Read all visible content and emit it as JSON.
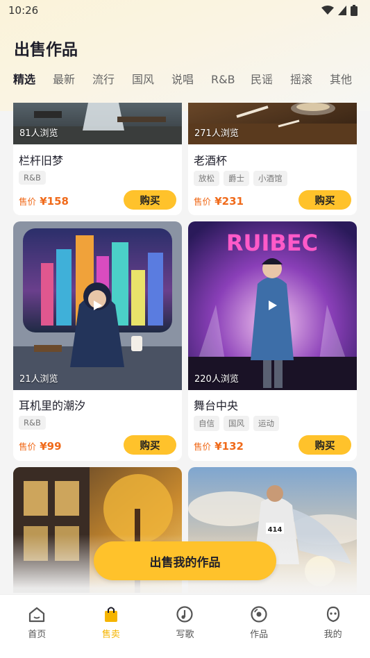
{
  "status": {
    "time": "10:26"
  },
  "page": {
    "title": "出售作品"
  },
  "tabs": [
    {
      "label": "精选",
      "active": true
    },
    {
      "label": "最新"
    },
    {
      "label": "流行"
    },
    {
      "label": "国风"
    },
    {
      "label": "说唱"
    },
    {
      "label": "R&B"
    },
    {
      "label": "民谣"
    },
    {
      "label": "摇滚"
    },
    {
      "label": "其他"
    }
  ],
  "cards": [
    {
      "views": "81人浏览",
      "title": "栏杆旧梦",
      "tags": [
        "R&B"
      ],
      "price_label": "售价",
      "price": "¥158",
      "buy": "购买"
    },
    {
      "views": "271人浏览",
      "title": "老酒杯",
      "tags": [
        "放松",
        "爵士",
        "小酒馆"
      ],
      "price_label": "售价",
      "price": "¥231",
      "buy": "购买"
    },
    {
      "views": "21人浏览",
      "title": "耳机里的潮汐",
      "tags": [
        "R&B"
      ],
      "price_label": "售价",
      "price": "¥99",
      "buy": "购买"
    },
    {
      "views": "220人浏览",
      "title": "舞台中央",
      "tags": [
        "自信",
        "国风",
        "运动"
      ],
      "price_label": "售价",
      "price": "¥132",
      "buy": "购买"
    }
  ],
  "sell_button": "出售我的作品",
  "nav": [
    {
      "label": "首页",
      "icon": "home-icon"
    },
    {
      "label": "售卖",
      "icon": "bag-icon",
      "active": true
    },
    {
      "label": "写歌",
      "icon": "compose-icon"
    },
    {
      "label": "作品",
      "icon": "disc-icon"
    },
    {
      "label": "我的",
      "icon": "profile-icon"
    }
  ],
  "colors": {
    "accent": "#ffc22b",
    "price": "#f06a1a",
    "active_nav": "#f5b400"
  }
}
